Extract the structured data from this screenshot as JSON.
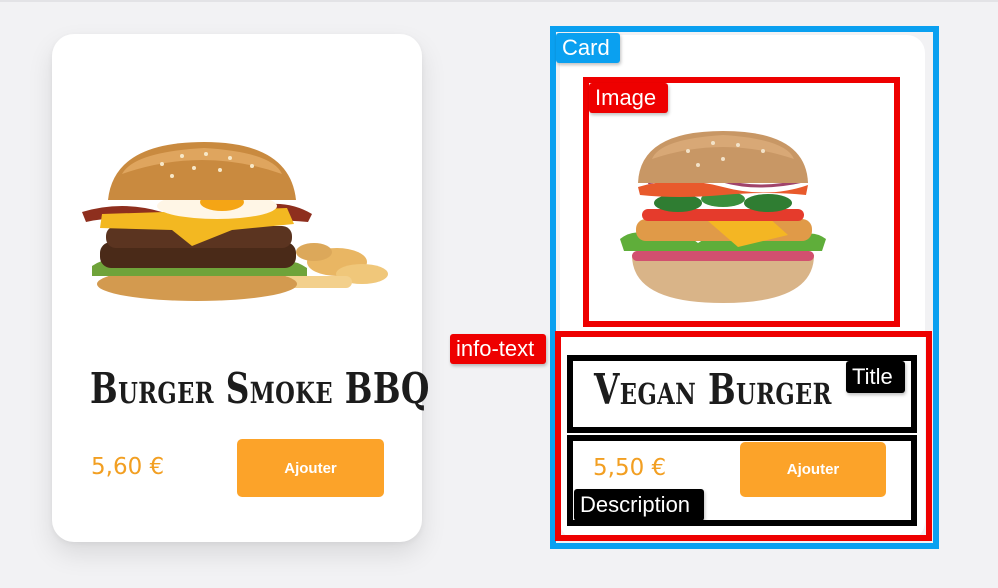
{
  "cards": [
    {
      "title": "Burger Smoke BBQ",
      "price": "5,60 €",
      "button_label": "Ajouter"
    },
    {
      "title": "Vegan Burger",
      "price": "5,50 €",
      "button_label": "Ajouter"
    }
  ],
  "annotations": {
    "card": "Card",
    "image": "Image",
    "info_text": "info-text",
    "title": "Title",
    "description": "Description"
  },
  "colors": {
    "background": "#f2f2f4",
    "card": "#ffffff",
    "price": "#f29f22",
    "button": "#fca329",
    "annotation_card": "#0aa0f0",
    "annotation_image": "#ee0000",
    "annotation_info_text": "#ee0000",
    "annotation_title": "#000000",
    "annotation_description": "#000000"
  }
}
